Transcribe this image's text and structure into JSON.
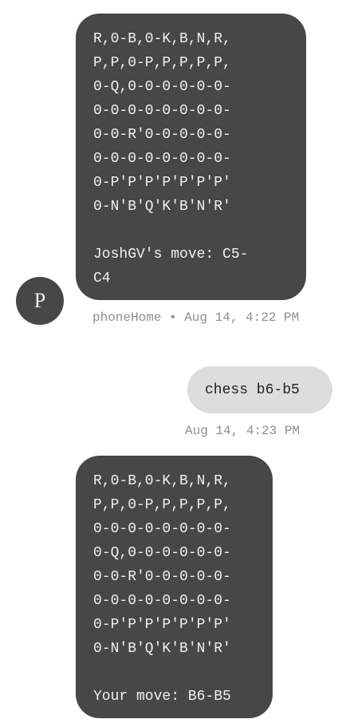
{
  "messages": [
    {
      "direction": "incoming",
      "text": "R,0-B,0-K,B,N,R,\nP,P,0-P,P,P,P,P,\n0-Q,0-0-0-0-0-0-\n0-0-0-0-0-0-0-0-\n0-0-R'0-0-0-0-0-\n0-0-0-0-0-0-0-0-\n0-P'P'P'P'P'P'P'\n0-N'B'Q'K'B'N'R'\n\nJoshGV's move: C5-\nC4",
      "sender_initial": "P",
      "meta": "phoneHome • Aug 14, 4:22 PM"
    },
    {
      "direction": "outgoing",
      "text": "chess b6-b5",
      "meta": "Aug 14, 4:23 PM"
    },
    {
      "direction": "incoming",
      "text": "R,0-B,0-K,B,N,R,\nP,P,0-P,P,P,P,P,\n0-0-0-0-0-0-0-0-\n0-Q,0-0-0-0-0-0-\n0-0-R'0-0-0-0-0-\n0-0-0-0-0-0-0-0-\n0-P'P'P'P'P'P'P'\n0-N'B'Q'K'B'N'R'\n\nYour move: B6-B5"
    }
  ],
  "colors": {
    "incoming_bubble": "#474747",
    "outgoing_bubble": "#dddddd",
    "meta_text": "#8e8e8e"
  }
}
